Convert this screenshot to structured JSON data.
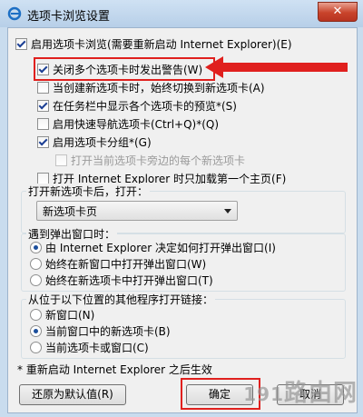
{
  "title": "选项卡浏览设置",
  "close_label": "✕",
  "enable_tabbed": "启用选项卡浏览(需要重新启动 Internet Explorer)(E)",
  "opts": [
    {
      "label": "关闭多个选项卡时发出警告(W)",
      "checked": true
    },
    {
      "label": "当创建新选项卡时，始终切换到新选项卡(A)",
      "checked": false
    },
    {
      "label": "在任务栏中显示各个选项卡的预览*(S)",
      "checked": true
    },
    {
      "label": "启用快速导航选项卡(Ctrl+Q)*(Q)",
      "checked": false
    },
    {
      "label": "启用选项卡分组*(G)",
      "checked": true
    },
    {
      "label": "打开当前选项卡旁边的每个新选项卡",
      "checked": false,
      "disabled": true
    },
    {
      "label": "打开 Internet Explorer 时只加载第一个主页(F)",
      "checked": false
    }
  ],
  "newtab_label": "打开新选项卡后，打开：",
  "newtab_value": "新选项卡页",
  "popup_label": "遇到弹出窗口时：",
  "popup_opts": [
    {
      "label": "由 Internet Explorer 决定如何打开弹出窗口(I)",
      "checked": true
    },
    {
      "label": "始终在新窗口中打开弹出窗口(W)",
      "checked": false
    },
    {
      "label": "始终在新选项卡中打开弹出窗口(T)",
      "checked": false
    }
  ],
  "links_label": "从位于以下位置的其他程序打开链接：",
  "links_opts": [
    {
      "label": "新窗口(N)",
      "checked": false
    },
    {
      "label": "当前窗口中的新选项卡(B)",
      "checked": true
    },
    {
      "label": "当前选项卡或窗口(C)",
      "checked": false
    }
  ],
  "note": "* 重新启动 Internet Explorer 之后生效",
  "restore_btn": "还原为默认值(R)",
  "ok_btn": "确定",
  "cancel_btn": "取消",
  "watermark_num": "191",
  "watermark_text": "路由网",
  "colors": {
    "highlight": "#e0201e",
    "titlebar": "#b7cfe8",
    "close": "#c9442b"
  }
}
